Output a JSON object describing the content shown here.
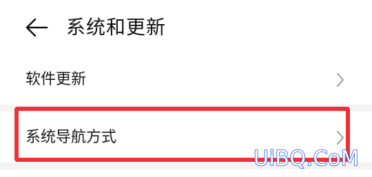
{
  "header": {
    "title": "系统和更新",
    "back_icon": "arrow-left-icon"
  },
  "list": {
    "items": [
      {
        "label": "软件更新",
        "icon": "chevron-right-icon"
      },
      {
        "label": "系统导航方式",
        "icon": "chevron-right-icon"
      }
    ]
  },
  "annotation": {
    "highlight_color": "#ef3036"
  },
  "watermark": {
    "text": "UiBQ.CoM",
    "color": "#2a5fd6"
  }
}
